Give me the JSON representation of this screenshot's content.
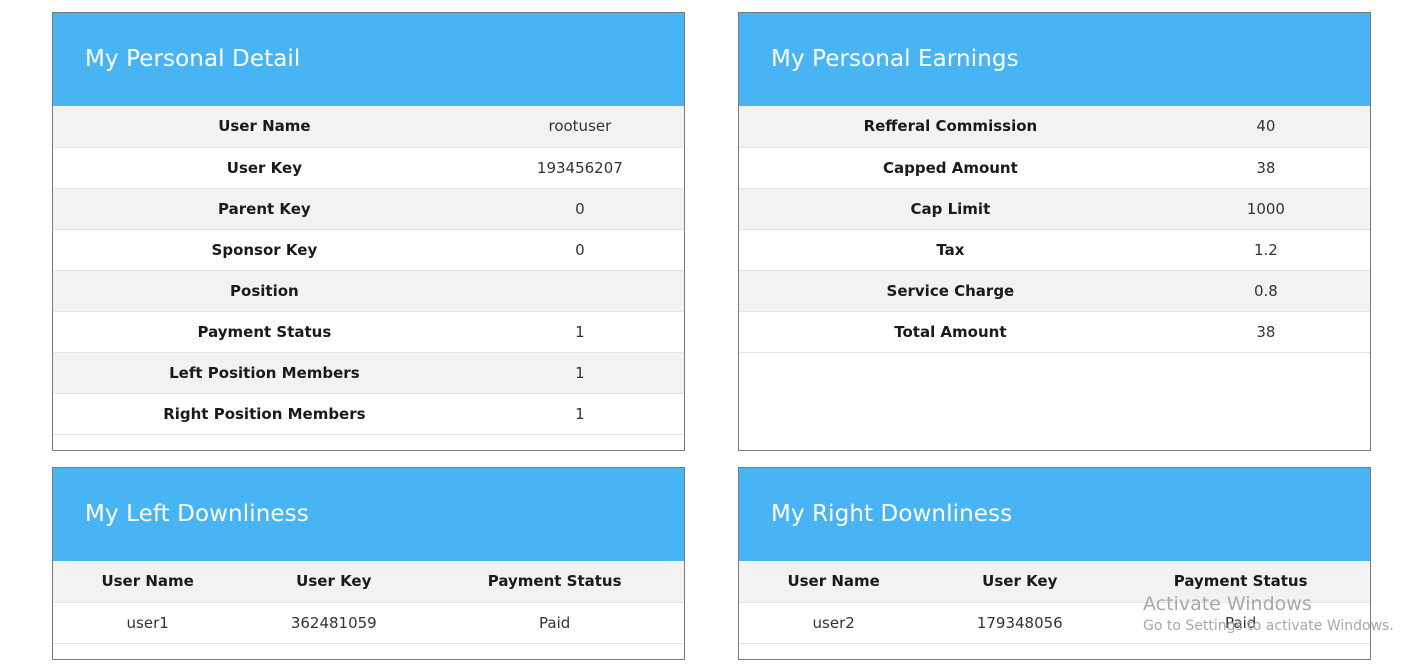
{
  "personal_detail": {
    "title": "My Personal Detail",
    "rows": [
      {
        "label": "User Name",
        "value": "rootuser"
      },
      {
        "label": "User Key",
        "value": "193456207"
      },
      {
        "label": "Parent Key",
        "value": "0"
      },
      {
        "label": "Sponsor Key",
        "value": "0"
      },
      {
        "label": "Position",
        "value": ""
      },
      {
        "label": "Payment Status",
        "value": "1"
      },
      {
        "label": "Left Position Members",
        "value": "1"
      },
      {
        "label": "Right Position Members",
        "value": "1"
      }
    ]
  },
  "personal_earnings": {
    "title": "My Personal Earnings",
    "rows": [
      {
        "label": "Refferal Commission",
        "value": "40"
      },
      {
        "label": "Capped Amount",
        "value": "38"
      },
      {
        "label": "Cap Limit",
        "value": "1000"
      },
      {
        "label": "Tax",
        "value": "1.2"
      },
      {
        "label": "Service Charge",
        "value": "0.8"
      },
      {
        "label": "Total Amount",
        "value": "38"
      }
    ]
  },
  "left_downline": {
    "title": "My Left Downliness",
    "headers": [
      "User Name",
      "User Key",
      "Payment Status"
    ],
    "rows": [
      [
        "user1",
        "362481059",
        "Paid"
      ]
    ]
  },
  "right_downline": {
    "title": "My Right Downliness",
    "headers": [
      "User Name",
      "User Key",
      "Payment Status"
    ],
    "rows": [
      [
        "user2",
        "179348056",
        "Paid"
      ]
    ]
  },
  "watermark": {
    "title": "Activate Windows",
    "subtitle": "Go to Settings to activate Windows."
  }
}
